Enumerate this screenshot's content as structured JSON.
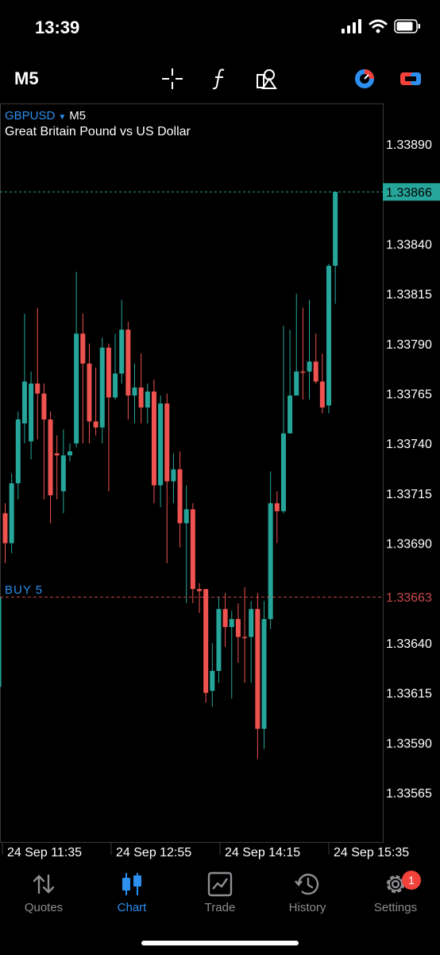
{
  "status": {
    "time": "13:39"
  },
  "toolbar": {
    "timeframe": "M5"
  },
  "chart": {
    "symbol": "GBPUSD",
    "timeframe": "M5",
    "description": "Great Britain Pound vs US Dollar",
    "bid_price": "1.33866",
    "order_label": "BUY 5",
    "order_price": "1.33663"
  },
  "chart_data": {
    "type": "candlestick",
    "ylim": [
      1.3354,
      1.33925
    ],
    "y_ticks": [
      "1.33890",
      "1.33840",
      "1.33815",
      "1.33790",
      "1.33765",
      "1.33740",
      "1.33715",
      "1.33690",
      "1.33640",
      "1.33615",
      "1.33590",
      "1.33565"
    ],
    "x_ticks": [
      "24 Sep 11:35",
      "24 Sep 12:55",
      "24 Sep 14:15",
      "24 Sep 15:35"
    ],
    "candles": [
      [
        1.3369,
        1.33705,
        1.3368,
        1.3371,
        "down"
      ],
      [
        1.3369,
        1.3372,
        1.33685,
        1.33725,
        "up"
      ],
      [
        1.3372,
        1.33752,
        1.33712,
        1.33756,
        "up"
      ],
      [
        1.3375,
        1.33771,
        1.3374,
        1.33805,
        "up"
      ],
      [
        1.33741,
        1.3377,
        1.33732,
        1.33776,
        "up"
      ],
      [
        1.3377,
        1.33765,
        1.33742,
        1.33808,
        "down"
      ],
      [
        1.33765,
        1.33752,
        1.33712,
        1.3377,
        "down"
      ],
      [
        1.33752,
        1.33714,
        1.337,
        1.33756,
        "down"
      ],
      [
        1.33735,
        1.33734,
        1.33712,
        1.33744,
        "down"
      ],
      [
        1.33716,
        1.33734,
        1.33705,
        1.33747,
        "up"
      ],
      [
        1.33734,
        1.33736,
        1.33731,
        1.3374,
        "up"
      ],
      [
        1.3374,
        1.33795,
        1.33738,
        1.33826,
        "up"
      ],
      [
        1.33795,
        1.3378,
        1.3374,
        1.33805,
        "down"
      ],
      [
        1.3378,
        1.33751,
        1.3374,
        1.3379,
        "down"
      ],
      [
        1.33751,
        1.33748,
        1.33744,
        1.33778,
        "down"
      ],
      [
        1.33748,
        1.33788,
        1.3374,
        1.33793,
        "up"
      ],
      [
        1.33788,
        1.33763,
        1.33716,
        1.3379,
        "down"
      ],
      [
        1.33763,
        1.33775,
        1.33762,
        1.33795,
        "up"
      ],
      [
        1.33775,
        1.33797,
        1.3377,
        1.33812,
        "up"
      ],
      [
        1.33797,
        1.33764,
        1.33752,
        1.33801,
        "down"
      ],
      [
        1.33764,
        1.33768,
        1.3375,
        1.3378,
        "up"
      ],
      [
        1.33768,
        1.33758,
        1.3375,
        1.33785,
        "down"
      ],
      [
        1.33758,
        1.33766,
        1.3375,
        1.3377,
        "up"
      ],
      [
        1.33766,
        1.33719,
        1.3371,
        1.33772,
        "down"
      ],
      [
        1.33719,
        1.3376,
        1.33708,
        1.33764,
        "up"
      ],
      [
        1.3376,
        1.33721,
        1.3368,
        1.33765,
        "down"
      ],
      [
        1.33721,
        1.33727,
        1.3371,
        1.33735,
        "up"
      ],
      [
        1.33727,
        1.337,
        1.33688,
        1.33736,
        "down"
      ],
      [
        1.337,
        1.33707,
        1.3366,
        1.33719,
        "up"
      ],
      [
        1.33707,
        1.33667,
        1.3366,
        1.3371,
        "down"
      ],
      [
        1.33667,
        1.33666,
        1.33655,
        1.3367,
        "down"
      ],
      [
        1.33667,
        1.33615,
        1.3361,
        1.33667,
        "down"
      ],
      [
        1.33616,
        1.33626,
        1.33608,
        1.3364,
        "up"
      ],
      [
        1.33626,
        1.33657,
        1.3362,
        1.33663,
        "up"
      ],
      [
        1.33657,
        1.33648,
        1.33638,
        1.33665,
        "down"
      ],
      [
        1.33648,
        1.33652,
        1.33612,
        1.33656,
        "up"
      ],
      [
        1.33652,
        1.33643,
        1.3363,
        1.3366,
        "down"
      ],
      [
        1.33643,
        1.33643,
        1.3362,
        1.33668,
        "down"
      ],
      [
        1.33643,
        1.33657,
        1.3362,
        1.33661,
        "up"
      ],
      [
        1.33657,
        1.33597,
        1.33582,
        1.33665,
        "down"
      ],
      [
        1.33597,
        1.33652,
        1.33587,
        1.33661,
        "up"
      ],
      [
        1.33652,
        1.3371,
        1.33647,
        1.33726,
        "up"
      ],
      [
        1.3371,
        1.33706,
        1.3369,
        1.33716,
        "down"
      ],
      [
        1.33706,
        1.33745,
        1.33705,
        1.33799,
        "up"
      ],
      [
        1.33745,
        1.33764,
        1.33745,
        1.33797,
        "up"
      ],
      [
        1.33764,
        1.33776,
        1.33765,
        1.33815,
        "up"
      ],
      [
        1.33776,
        1.33776,
        1.33762,
        1.33808,
        "down"
      ],
      [
        1.33776,
        1.33781,
        1.33762,
        1.33812,
        "up"
      ],
      [
        1.33781,
        1.33771,
        1.3377,
        1.33795,
        "down"
      ],
      [
        1.33771,
        1.33758,
        1.33755,
        1.33785,
        "down"
      ],
      [
        1.33759,
        1.33829,
        1.33755,
        1.3383,
        "up"
      ],
      [
        1.33829,
        1.33866,
        1.3381,
        1.33866,
        "up"
      ]
    ],
    "colors": {
      "up": "#26a69a",
      "down": "#ef5350",
      "bid": "#26a69a",
      "order": "#c94a4a",
      "grid": "#3a3a3c"
    }
  },
  "tabs": [
    {
      "label": "Quotes",
      "icon": "quotes-icon"
    },
    {
      "label": "Chart",
      "icon": "candlestick-icon"
    },
    {
      "label": "Trade",
      "icon": "trade-icon"
    },
    {
      "label": "History",
      "icon": "history-icon"
    },
    {
      "label": "Settings",
      "icon": "gear-icon",
      "badge": "1"
    }
  ]
}
